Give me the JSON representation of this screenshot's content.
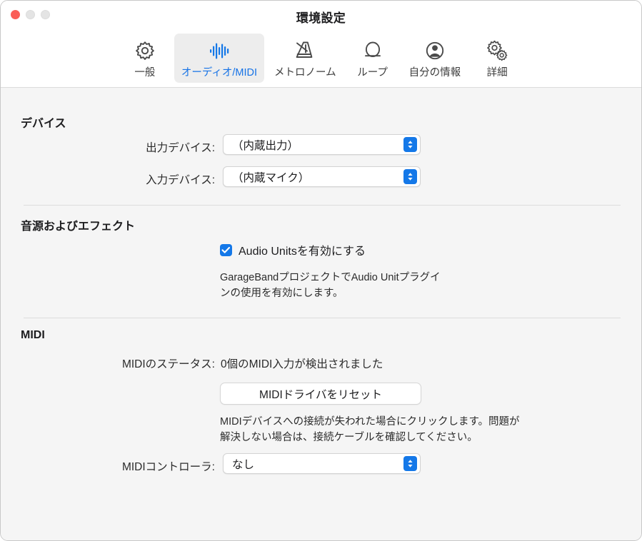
{
  "window": {
    "title": "環境設定",
    "traffic_lights": {
      "close": "close",
      "minimize": "minimize",
      "maximize": "maximize"
    },
    "accent_color": "#1478e8",
    "selected_tab_text_color": "#1673e6",
    "background_color": "#f5f5f5",
    "toolbar_background_color": "#ffffff"
  },
  "toolbar": {
    "items": [
      {
        "id": "general",
        "label": "一般",
        "icon": "gear-icon",
        "selected": false
      },
      {
        "id": "audio-midi",
        "label": "オーディオ/MIDI",
        "icon": "waveform-icon",
        "selected": true
      },
      {
        "id": "metronome",
        "label": "メトロノーム",
        "icon": "metronome-icon",
        "selected": false
      },
      {
        "id": "loops",
        "label": "ループ",
        "icon": "loop-icon",
        "selected": false
      },
      {
        "id": "my-info",
        "label": "自分の情報",
        "icon": "person-icon",
        "selected": false
      },
      {
        "id": "advanced",
        "label": "詳細",
        "icon": "double-gear-icon",
        "selected": false
      }
    ]
  },
  "sections": {
    "devices": {
      "title": "デバイス",
      "output": {
        "label": "出力デバイス:",
        "value": "（内蔵出力）"
      },
      "input": {
        "label": "入力デバイス:",
        "value": "（内蔵マイク）"
      }
    },
    "instruments_effects": {
      "title": "音源およびエフェクト",
      "audio_units_checkbox": {
        "label": "Audio Unitsを有効にする",
        "checked": true
      },
      "description_line1": "GarageBandプロジェクトでAudio Unitプラグイ",
      "description_line2": "ンの使用を有効にします。"
    },
    "midi": {
      "title": "MIDI",
      "status": {
        "label": "MIDIのステータス:",
        "value": "0個のMIDI入力が検出されました"
      },
      "reset_button": "MIDIドライバをリセット",
      "reset_description_line1": "MIDIデバイスへの接続が失われた場合にクリックします。問題が",
      "reset_description_line2": "解決しない場合は、接続ケーブルを確認してください。",
      "controller": {
        "label": "MIDIコントローラ:",
        "value": "なし"
      }
    }
  }
}
